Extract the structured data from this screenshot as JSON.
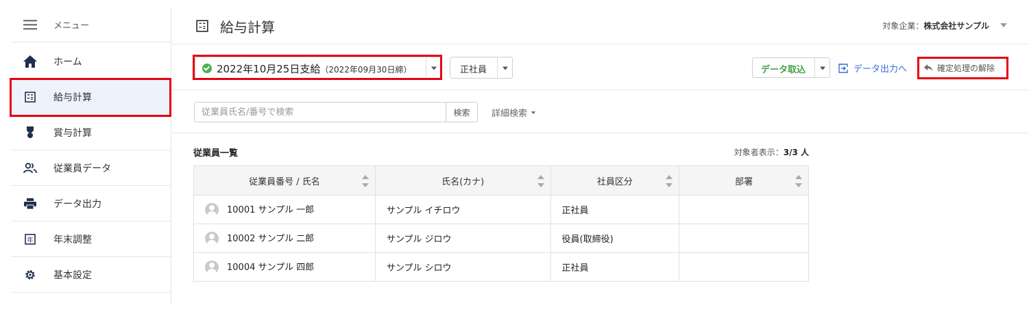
{
  "sidebar": {
    "menu_label": "メニュー",
    "items": [
      {
        "label": "ホーム",
        "icon": "home-icon"
      },
      {
        "label": "給与計算",
        "icon": "calculator-icon",
        "active": true
      },
      {
        "label": "賞与計算",
        "icon": "medal-icon"
      },
      {
        "label": "従業員データ",
        "icon": "people-icon"
      },
      {
        "label": "データ出力",
        "icon": "printer-icon"
      },
      {
        "label": "年末調整",
        "icon": "year-icon"
      },
      {
        "label": "基本設定",
        "icon": "gear-icon"
      }
    ]
  },
  "header": {
    "title": "給与計算",
    "company_prefix": "対象企業：",
    "company_name": "株式会社サンプル"
  },
  "toolbar": {
    "pay_period": "2022年10月25日支給",
    "pay_period_sub": "（2022年09月30日締）",
    "employment_type": "正社員",
    "import_label": "データ取込",
    "export_label": "データ出力へ",
    "undo_label": "確定処理の解除"
  },
  "search": {
    "placeholder": "従業員氏名/番号で検索",
    "button": "検索",
    "advanced": "詳細検索"
  },
  "list": {
    "title": "従業員一覧",
    "count_prefix": "対象者表示：",
    "count_value": "3/3 人",
    "columns": [
      "従業員番号 / 氏名",
      "氏名(カナ)",
      "社員区分",
      "部署"
    ],
    "rows": [
      {
        "id_name": "10001  サンプル 一郎",
        "kana": "サンプル イチロウ",
        "type": "正社員",
        "dept": ""
      },
      {
        "id_name": "10002  サンプル 二郎",
        "kana": "サンプル ジロウ",
        "type": "役員(取締役)",
        "dept": ""
      },
      {
        "id_name": "10004  サンプル 四郎",
        "kana": "サンプル シロウ",
        "type": "正社員",
        "dept": ""
      }
    ]
  },
  "colors": {
    "highlight": "#e60012",
    "accent_green": "#43a047",
    "link_blue": "#3b6cd4",
    "active_bg": "#eef2fb"
  }
}
